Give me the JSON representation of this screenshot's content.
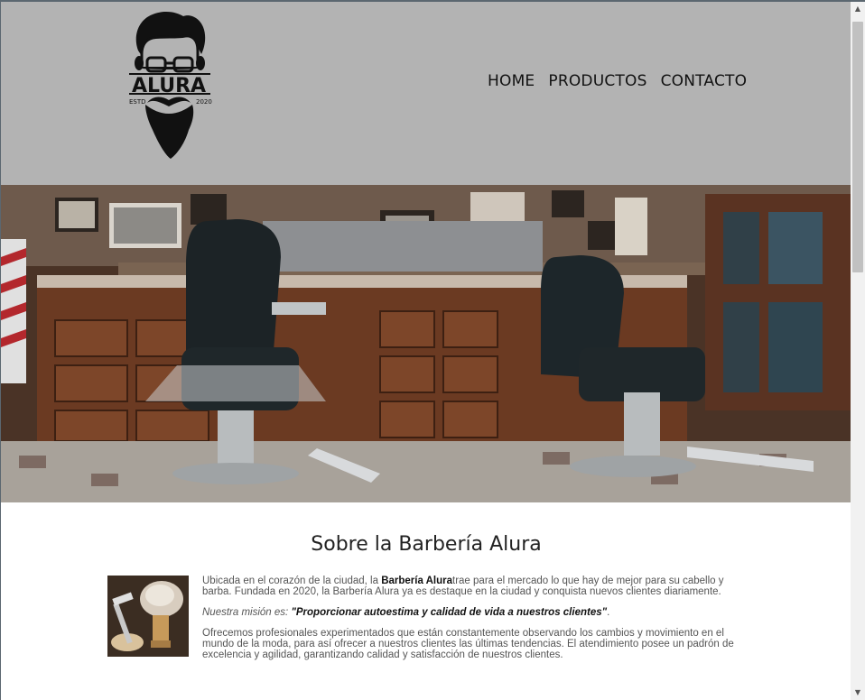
{
  "logo": {
    "name": "ALURA",
    "estd_label": "ESTD",
    "estd_year": "2020"
  },
  "nav": {
    "items": [
      {
        "label": "HOME"
      },
      {
        "label": "PRODUCTOS"
      },
      {
        "label": "CONTACTO"
      }
    ]
  },
  "main": {
    "title": "Sobre la Barbería Alura",
    "p1_before": "Ubicada en el corazón de la ciudad, la ",
    "p1_brand": "Barbería Alura",
    "p1_after": "trae para el mercado lo que hay de mejor para su cabello y barba. Fundada en 2020, la Barbería Alura ya es destaque en la ciudad y conquista nuevos clientes diariamente.",
    "mission_label": "Nuestra misión es: ",
    "mission_quote": "\"Proporcionar autoestima y calidad de vida a nuestros clientes\"",
    "mission_end": ".",
    "p3": "Ofrecemos profesionales experimentados que están constantemente observando los cambios y movimiento en el mundo de la moda, para así ofrecer a nuestros clientes las últimas tendencias. El atendimiento posee un padrón de excelencia y agilidad, garantizando calidad y satisfacción de nuestros clientes."
  },
  "scrollbar": {
    "up_arrow": "▲",
    "down_arrow": "▼"
  },
  "colors": {
    "header_bg": "#b3b3b3",
    "page_bg": "#ffffff",
    "text_dark": "#111111",
    "text_body": "#555555"
  }
}
